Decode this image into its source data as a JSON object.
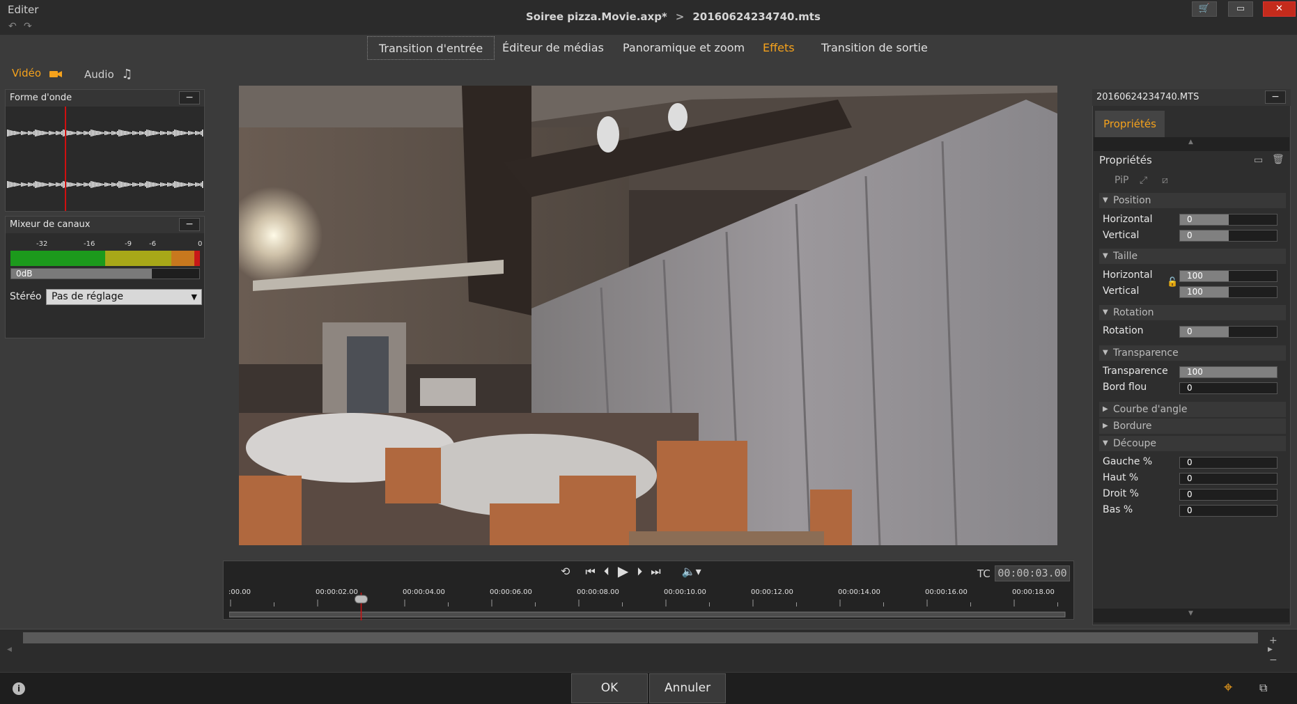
{
  "window": {
    "menu_label": "Editer",
    "breadcrumb_project": "Soiree pizza.Movie.axp*",
    "breadcrumb_sep": ">",
    "breadcrumb_clip": "20160624234740.mts"
  },
  "tabs": [
    {
      "label": "Transition d'entrée"
    },
    {
      "label": "Éditeur de médias"
    },
    {
      "label": "Panoramique et zoom"
    },
    {
      "label": "Effets"
    },
    {
      "label": "Transition de sortie"
    }
  ],
  "mode": {
    "video_label": "Vidéo",
    "audio_label": "Audio"
  },
  "waveform_panel": {
    "title": "Forme d'onde",
    "collapse": "−"
  },
  "mixer_panel": {
    "title": "Mixeur de canaux",
    "collapse": "−",
    "scale": [
      "-32",
      "-16",
      "-9",
      "-6",
      "0"
    ],
    "gain_label": "0dB",
    "stereo_label": "Stéréo",
    "stereo_value": "Pas de réglage"
  },
  "transport": {
    "tc_label": "TC",
    "timecode": "00:00:03.00",
    "ticks": [
      ":00.00",
      "00:00:02.00",
      "00:00:04.00",
      "00:00:06.00",
      "00:00:08.00",
      "00:00:10.00",
      "00:00:12.00",
      "00:00:14.00",
      "00:00:16.00",
      "00:00:18.00"
    ],
    "playhead_seconds": 3.0
  },
  "properties_panel": {
    "clip_name": "20160624234740.MTS",
    "collapse": "−",
    "tab_label": "Propriétés",
    "title": "Propriétés",
    "pip_label": "PiP",
    "sections": {
      "position": "Position",
      "size": "Taille",
      "rotation": "Rotation",
      "transparency": "Transparence",
      "corner": "Courbe d'angle",
      "border": "Bordure",
      "crop": "Découpe"
    },
    "fields": {
      "pos_h": {
        "label": "Horizontal",
        "value": "0",
        "fill": 0.5
      },
      "pos_v": {
        "label": "Vertical",
        "value": "0",
        "fill": 0.5
      },
      "size_h": {
        "label": "Horizontal",
        "value": "100",
        "fill": 0.5
      },
      "size_v": {
        "label": "Vertical",
        "value": "100",
        "fill": 0.5
      },
      "rotation": {
        "label": "Rotation",
        "value": "0",
        "fill": 0.5
      },
      "transparency": {
        "label": "Transparence",
        "value": "100",
        "fill": 1.0
      },
      "soft_edge": {
        "label": "Bord flou",
        "value": "0",
        "fill": 0.0
      },
      "crop_left": {
        "label": "Gauche %",
        "value": "0",
        "fill": 0.0
      },
      "crop_top": {
        "label": "Haut %",
        "value": "0",
        "fill": 0.0
      },
      "crop_right": {
        "label": "Droit %",
        "value": "0",
        "fill": 0.0
      },
      "crop_bottom": {
        "label": "Bas %",
        "value": "0",
        "fill": 0.0
      }
    }
  },
  "footer": {
    "ok_label": "OK",
    "cancel_label": "Annuler"
  },
  "colors": {
    "accent": "#f5a21c",
    "close": "#c42b1c"
  }
}
